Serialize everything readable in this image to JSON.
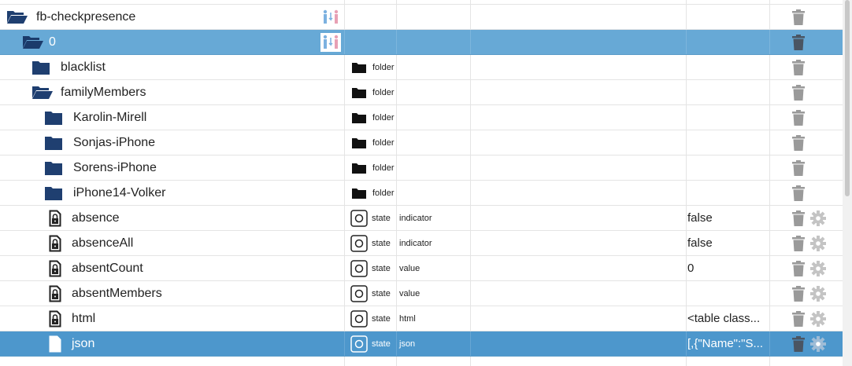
{
  "tree": {
    "rows": [
      {
        "name": "fb-checkpresence",
        "type": "",
        "role": "",
        "value": "",
        "kind": "folder-open",
        "depth": 0,
        "badge": true,
        "gear": false,
        "selected": false
      },
      {
        "name": "0",
        "type": "",
        "role": "",
        "value": "",
        "kind": "folder-open",
        "depth": 1,
        "badge": true,
        "gear": false,
        "selected": true
      },
      {
        "name": "blacklist",
        "type": "folder",
        "role": "",
        "value": "",
        "kind": "folder",
        "depth": 2,
        "badge": false,
        "gear": false,
        "selected": false
      },
      {
        "name": "familyMembers",
        "type": "folder",
        "role": "",
        "value": "",
        "kind": "folder-open",
        "depth": 2,
        "badge": false,
        "gear": false,
        "selected": false
      },
      {
        "name": "Karolin-Mirell",
        "type": "folder",
        "role": "",
        "value": "",
        "kind": "folder",
        "depth": 3,
        "badge": false,
        "gear": false,
        "selected": false
      },
      {
        "name": "Sonjas-iPhone",
        "type": "folder",
        "role": "",
        "value": "",
        "kind": "folder",
        "depth": 3,
        "badge": false,
        "gear": false,
        "selected": false
      },
      {
        "name": "Sorens-iPhone",
        "type": "folder",
        "role": "",
        "value": "",
        "kind": "folder",
        "depth": 3,
        "badge": false,
        "gear": false,
        "selected": false
      },
      {
        "name": "iPhone14-Volker",
        "type": "folder",
        "role": "",
        "value": "",
        "kind": "folder",
        "depth": 3,
        "badge": false,
        "gear": false,
        "selected": false
      },
      {
        "name": "absence",
        "type": "state",
        "role": "indicator",
        "value": "false",
        "kind": "state",
        "depth": 3,
        "badge": false,
        "gear": true,
        "selected": false
      },
      {
        "name": "absenceAll",
        "type": "state",
        "role": "indicator",
        "value": "false",
        "kind": "state",
        "depth": 3,
        "badge": false,
        "gear": true,
        "selected": false
      },
      {
        "name": "absentCount",
        "type": "state",
        "role": "value",
        "value": "0",
        "kind": "state",
        "depth": 3,
        "badge": false,
        "gear": true,
        "selected": false
      },
      {
        "name": "absentMembers",
        "type": "state",
        "role": "value",
        "value": "",
        "kind": "state",
        "depth": 3,
        "badge": false,
        "gear": true,
        "selected": false
      },
      {
        "name": "html",
        "type": "state",
        "role": "html",
        "value": "<table class...",
        "kind": "state",
        "depth": 3,
        "badge": false,
        "gear": true,
        "selected": false
      },
      {
        "name": "json",
        "type": "state",
        "role": "json",
        "value": "[,{\"Name\":\"S...",
        "kind": "state",
        "depth": 3,
        "badge": false,
        "gear": true,
        "selected": true
      }
    ]
  },
  "colors": {
    "folder": "#1f3f70",
    "selected_row": "#67a9d6",
    "trash": "#9a9a9a",
    "gear": "#c4c4c4",
    "badge_blue": "#7cb1e0",
    "badge_pink": "#e8a0b4"
  },
  "icons": {
    "folder": "folder-icon",
    "folder_open": "folder-open-icon",
    "state": "lock-file-icon",
    "type_folder": "black-folder-icon",
    "type_state": "state-circle-icon",
    "trash": "trash-icon",
    "gear": "gear-icon",
    "badge": "enum-badge-icon"
  }
}
